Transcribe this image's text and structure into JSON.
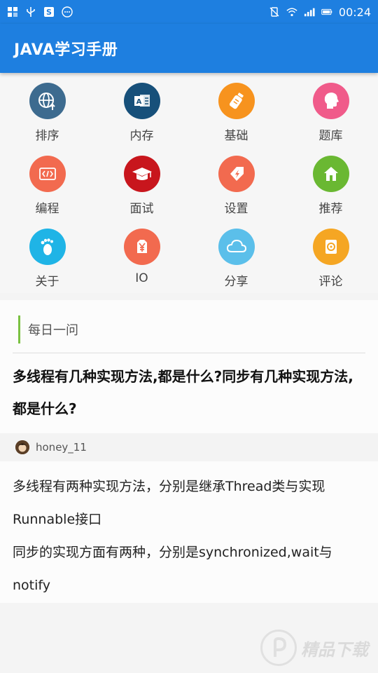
{
  "status": {
    "time": "00:24",
    "left_icons": [
      "apps-icon",
      "usb-icon",
      "s-app-icon",
      "more-icon"
    ],
    "right_icons": [
      "vibrate-off-icon",
      "wifi-icon",
      "signal-icon",
      "battery-icon"
    ]
  },
  "header": {
    "title": "JAVA学习手册"
  },
  "grid": {
    "items": [
      {
        "label": "排序",
        "icon": "globe-upload-icon",
        "color": "#3d6b8f"
      },
      {
        "label": "内存",
        "icon": "outlook-icon",
        "color": "#17507a"
      },
      {
        "label": "基础",
        "icon": "bottle-icon",
        "color": "#f7931e"
      },
      {
        "label": "题库",
        "icon": "head-icon",
        "color": "#f05b8a"
      },
      {
        "label": "编程",
        "icon": "code-icon",
        "color": "#f26a4f"
      },
      {
        "label": "面试",
        "icon": "graduation-cap-icon",
        "color": "#c8161d"
      },
      {
        "label": "设置",
        "icon": "lightning-tag-icon",
        "color": "#f26a4f"
      },
      {
        "label": "推荐",
        "icon": "home-icon",
        "color": "#6ab832"
      },
      {
        "label": "关于",
        "icon": "footprint-icon",
        "color": "#1fb4e6"
      },
      {
        "label": "IO",
        "icon": "yen-icon",
        "color": "#f26a4f"
      },
      {
        "label": "分享",
        "icon": "cloud-icon",
        "color": "#5bbfea"
      },
      {
        "label": "评论",
        "icon": "disc-icon",
        "color": "#f5a623"
      }
    ]
  },
  "daily": {
    "section_title": "每日一问",
    "question": "多线程有几种实现方法,都是什么?同步有几种实现方法,都是什么?",
    "user": "honey_11",
    "answer_lines": [
      "多线程有两种实现方法，分别是继承Thread类与实现Runnable接口",
      "同步的实现方面有两种，分别是synchronized,wait与notify"
    ]
  },
  "watermark": {
    "text": "精品下载"
  },
  "colors": {
    "primary": "#1e7fe0",
    "accent_bar": "#7ac142"
  }
}
